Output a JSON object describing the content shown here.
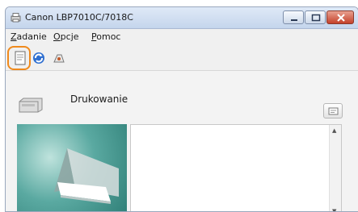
{
  "window": {
    "title": "Canon LBP7010C/7018C"
  },
  "menu": {
    "items": [
      "Zadanie",
      "Opcje",
      "Pomoc"
    ]
  },
  "toolbar": {
    "icons": [
      "printer-status-icon",
      "refresh-icon",
      "printer-tool-icon"
    ],
    "highlight_color": "#f08a1c"
  },
  "status": {
    "label": "Drukowanie"
  },
  "colors": {
    "titlebar": "#c4d5ec",
    "close_button": "#c4412a",
    "image_teal": "#2d7d75"
  }
}
